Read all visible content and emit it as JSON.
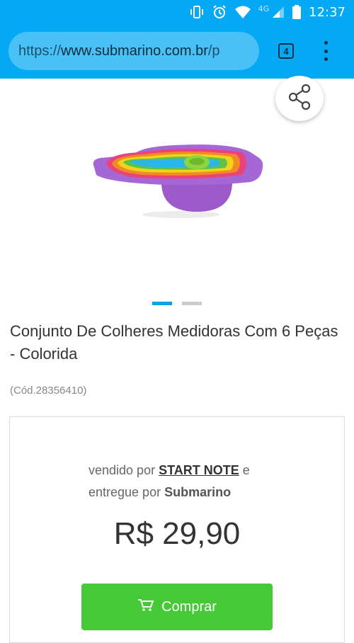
{
  "status_bar": {
    "network": "4G",
    "time": "12:37",
    "icons": [
      "vibrate-icon",
      "alarm-icon",
      "wifi-icon",
      "signal-icon",
      "battery-icon"
    ]
  },
  "browser": {
    "url_scheme": "https://",
    "url_host": "www.submarino.com.br",
    "url_rest": "/p",
    "tab_count": "4"
  },
  "product": {
    "title": "Conjunto De Colheres Medidoras Com 6 Peças - Colorida",
    "code": "(Cód.28356410)",
    "image_count": 2,
    "active_image": 1
  },
  "offer": {
    "sold_by_prefix": "vendido por",
    "seller_name": "START NOTE",
    "connector": "e",
    "delivered_by_prefix": "entregue por",
    "delivered_by": "Submarino",
    "price": "R$ 29,90",
    "buy_label": "Comprar"
  },
  "colors": {
    "header_blue": "#03a9f4",
    "buy_green": "#45c936",
    "dot_active": "#0aa3e0"
  }
}
